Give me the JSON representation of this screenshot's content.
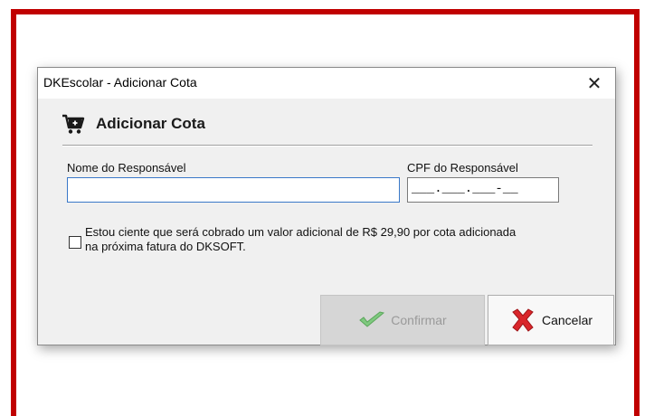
{
  "dialog": {
    "title": "DKEscolar - Adicionar Cota",
    "close_glyph": "✕",
    "header_icon": "cart-add-icon",
    "header_title": "Adicionar Cota"
  },
  "form": {
    "nome_label": "Nome do Responsável",
    "nome_value": "",
    "cpf_label": "CPF do Responsável",
    "cpf_mask": "___.___.___-__"
  },
  "terms": {
    "checked": false,
    "text_line1": "Estou ciente que será cobrado um valor adicional de R$ 29,90 por cota adicionada",
    "text_line2": "na próxima fatura do DKSOFT."
  },
  "buttons": {
    "confirm_label": "Confirmar",
    "confirm_icon": "checkmark-icon",
    "confirm_enabled": false,
    "cancel_label": "Cancelar",
    "cancel_icon": "red-x-icon"
  },
  "colors": {
    "frame_border": "#c00000",
    "input_focus_border": "#3a78c8",
    "confirm_check": "#7fc97f",
    "cancel_x": "#d9262b"
  }
}
